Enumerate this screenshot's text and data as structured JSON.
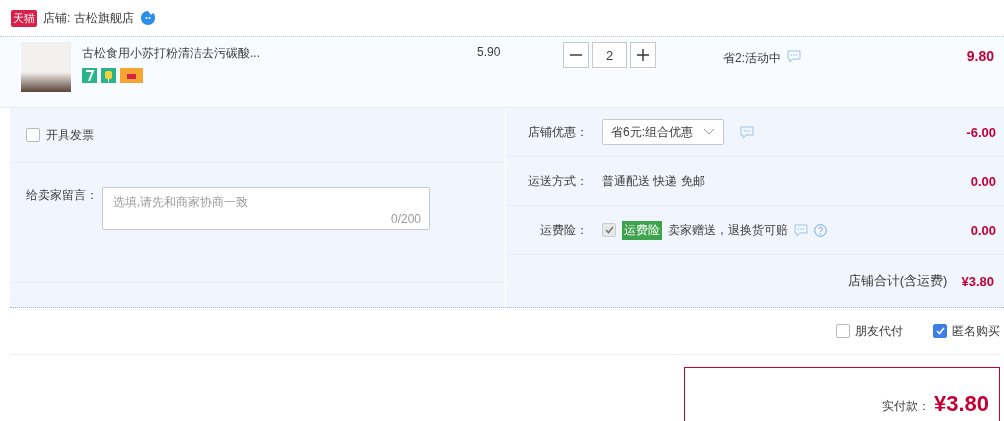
{
  "shop": {
    "badge": "天猫",
    "label": "店铺: 古松旗舰店"
  },
  "item": {
    "title": "古松食用小苏打粉清洁去污碳酸...",
    "price": "5.90",
    "quantity": "2",
    "promo": "省2:活动中",
    "subtotal": "9.80"
  },
  "invoice": {
    "label": "开具发票",
    "checked": false
  },
  "message": {
    "label": "给卖家留言：",
    "placeholder": "选填,请先和商家协商一致",
    "counter": "0/200"
  },
  "discount": {
    "label": "店铺优惠：",
    "value": "省6元:组合优惠",
    "amount": "-6.00"
  },
  "shipping": {
    "label": "运送方式：",
    "value": "普通配送 快递 免邮",
    "amount": "0.00"
  },
  "insurance": {
    "label": "运费险：",
    "checked": true,
    "disabled": true,
    "tag": "运费险",
    "text": "卖家赠送，退换货可赔",
    "amount": "0.00"
  },
  "shop_total": {
    "label": "店铺合计(含运费)",
    "value": "¥3.80"
  },
  "options": [
    {
      "label": "朋友代付",
      "checked": false
    },
    {
      "label": "匿名购买",
      "checked": true
    }
  ],
  "payment": {
    "label": "实付款：",
    "value": "¥3.80"
  }
}
